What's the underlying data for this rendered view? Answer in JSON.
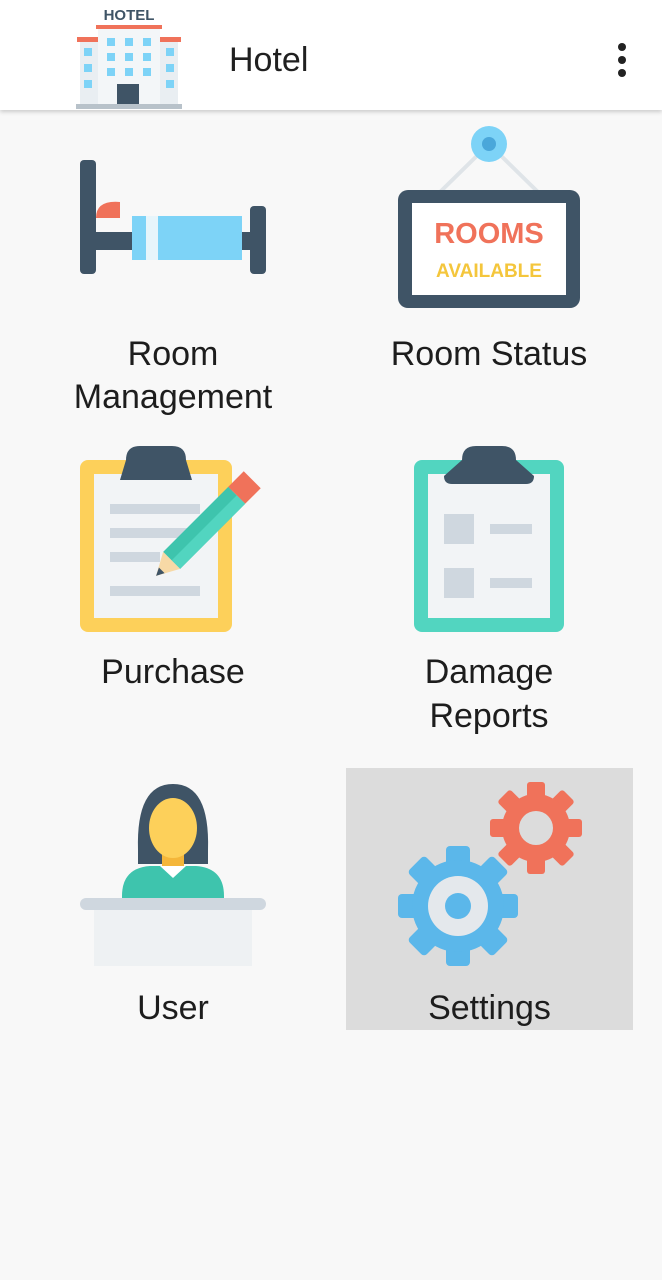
{
  "appbar": {
    "title": "Hotel",
    "logo_text": "HOTEL",
    "overflow_icon": "more-vert-icon"
  },
  "tiles": [
    {
      "id": "room-management",
      "label_line1": "Room",
      "label_line2": "Management",
      "icon": "bed-icon"
    },
    {
      "id": "room-status",
      "label": "Room Status",
      "icon": "rooms-available-sign-icon",
      "sign_line1": "ROOMS",
      "sign_line2": "AVAILABLE"
    },
    {
      "id": "purchase",
      "label": "Purchase",
      "icon": "clipboard-pencil-icon"
    },
    {
      "id": "damage-reports",
      "label_line1": "Damage",
      "label_line2": "Reports",
      "icon": "clipboard-checklist-icon"
    },
    {
      "id": "user",
      "label": "User",
      "icon": "receptionist-icon"
    },
    {
      "id": "settings",
      "label": "Settings",
      "icon": "gears-icon",
      "selected": true
    }
  ],
  "colors": {
    "appbar_bg": "#ffffff",
    "page_bg": "#f8f8f8",
    "selected_bg": "#dcdcdc",
    "slate": "#3f5466",
    "sky": "#7dd3f7",
    "coral": "#f0725a",
    "yellow": "#fdd05a",
    "teal": "#52d5c0"
  }
}
